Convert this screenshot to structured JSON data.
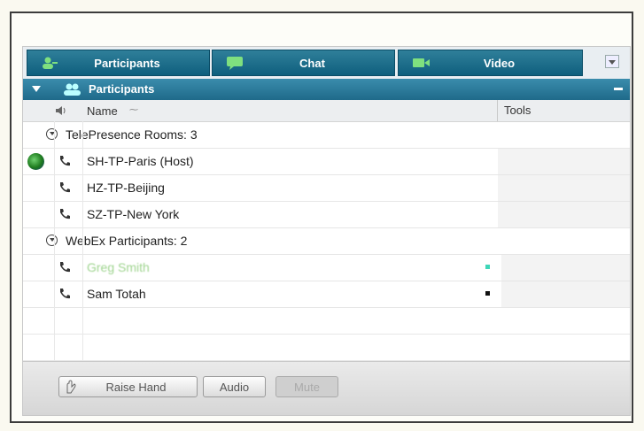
{
  "tabs": [
    {
      "label": "Participants",
      "icon": "participant-icon"
    },
    {
      "label": "Chat",
      "icon": "chat-icon"
    },
    {
      "label": "Video",
      "icon": "video-icon"
    }
  ],
  "panel": {
    "title": "Participants",
    "collapse_icon": "minus-icon"
  },
  "columns": {
    "name": "Name",
    "sort_indicator": "⁓",
    "tools": "Tools"
  },
  "groups": [
    {
      "label": "TelePresence Rooms: 3",
      "participants": [
        {
          "name": "SH-TP-Paris (Host)",
          "host": true
        },
        {
          "name": "HZ-TP-Beijing"
        },
        {
          "name": "SZ-TP-New York"
        }
      ]
    },
    {
      "label": "WebEx Participants: 2",
      "participants": [
        {
          "name": "Greg Smith",
          "state": "greyed"
        },
        {
          "name": "Sam Totah"
        }
      ]
    }
  ],
  "footer": {
    "raise_hand": "Raise Hand",
    "audio": "Audio",
    "mute": "Mute"
  },
  "colors": {
    "accent": "#1f6a8a",
    "tab": "#0f5f7e",
    "speaking": "#3fd6b8"
  }
}
